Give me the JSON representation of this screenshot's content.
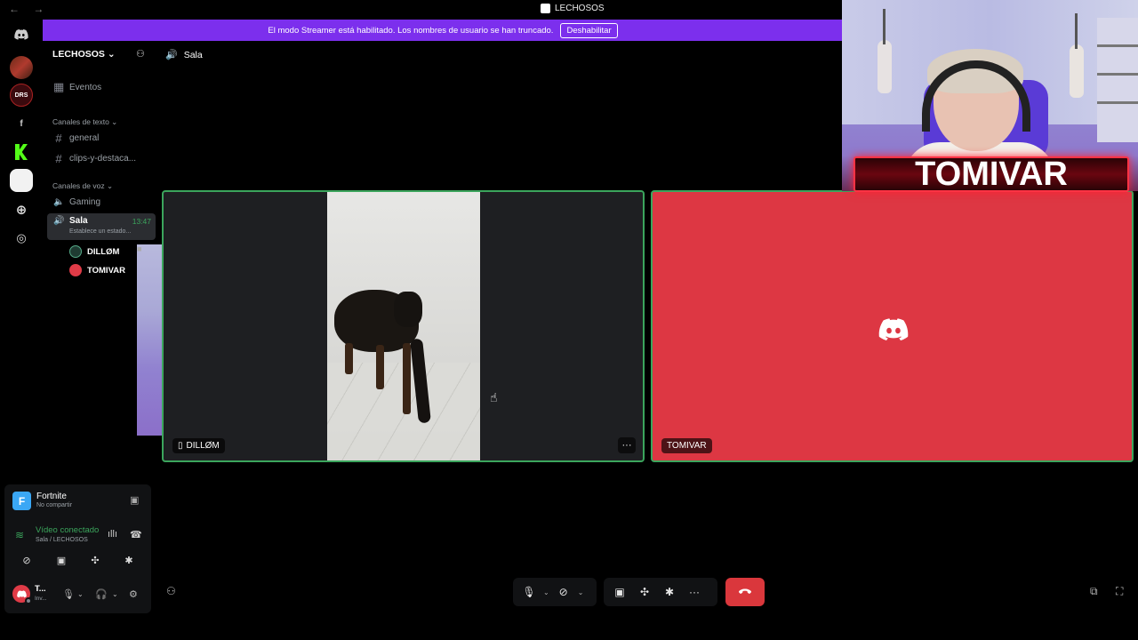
{
  "window": {
    "title": "LECHOSOS",
    "nav": "← →"
  },
  "banner": {
    "text": "El modo Streamer está habilitado. Los nombres de usuario se han truncado.",
    "button": "Deshabilitar"
  },
  "server": {
    "name": "LECHOSOS ⌄"
  },
  "sidebar": {
    "events": "Eventos",
    "text_category": "Canales de texto ⌄",
    "text_channels": [
      "general",
      "clips-y-destaca..."
    ],
    "voice_category": "Canales de voz ⌄",
    "voice_channels": {
      "gaming": "Gaming",
      "sala": {
        "name": "Sala",
        "time": "13:47",
        "status": "Establece un estado..."
      }
    },
    "members": [
      "DILLØM",
      "TOMIVAR"
    ]
  },
  "panel": {
    "activity": {
      "icon": "F",
      "name": "Fortnite",
      "sub": "No compartir"
    },
    "voice": {
      "name": "Vídeo conectado",
      "sub": "Sala / LECHOSOS"
    },
    "user": {
      "name": "T...",
      "sub": "Inv..."
    }
  },
  "main": {
    "channel": "Sala",
    "tiles": [
      {
        "name": "DILLØM",
        "mobile_icon": "▯",
        "more": "···"
      },
      {
        "name": "TOMIVAR"
      }
    ]
  },
  "overlay": {
    "name_plate": "TOMIVAR"
  },
  "colors": {
    "banner": "#7c2fed",
    "speaking": "#3ba55c",
    "tile_red": "#dd3743",
    "leave": "#da373c"
  },
  "icons": {
    "events": "calendar-icon",
    "hash": "hash-icon",
    "speaker": "speaker-icon",
    "camera": "camera-icon",
    "mic": "mic-icon",
    "headphones": "headphones-icon",
    "settings": "gear-icon",
    "leave": "phone-hangup-icon"
  }
}
